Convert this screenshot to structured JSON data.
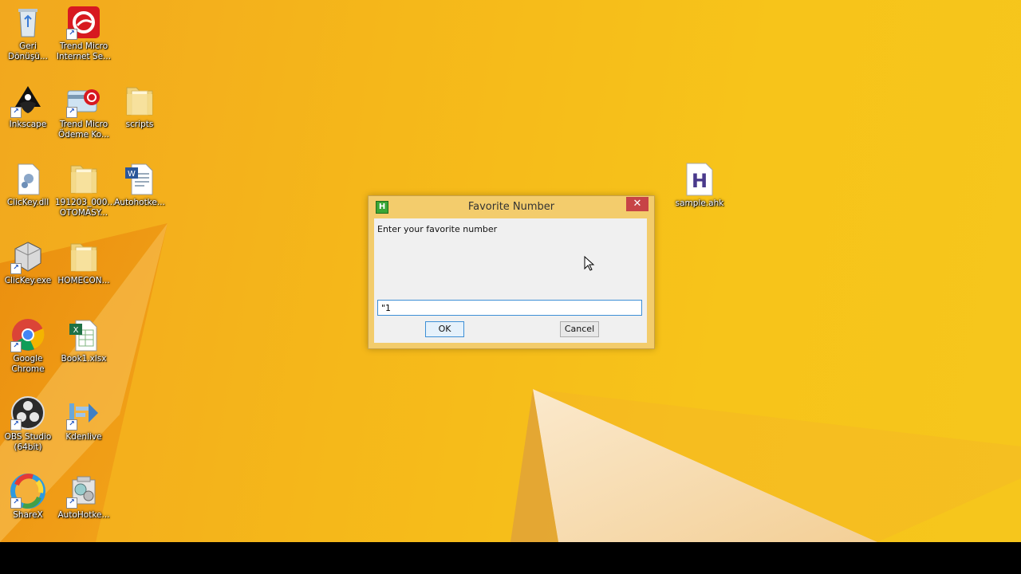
{
  "desktop": {
    "wallpaper_colors": {
      "base": "#f5b81c",
      "orange": "#f08a10",
      "light": "#f7d9a8"
    },
    "icons": [
      {
        "label": "Geri\nDönüşü...",
        "icon": "recycle-bin-icon"
      },
      {
        "label": "Trend Micro\nInternet Se...",
        "icon": "trend-micro-icon"
      },
      {
        "label": "Inkscape",
        "icon": "inkscape-icon"
      },
      {
        "label": "Trend Micro\nÖdeme Ko...",
        "icon": "trend-micro-payment-icon"
      },
      {
        "label": "scripts",
        "icon": "folder-icon"
      },
      {
        "label": "ClicKey.dll",
        "icon": "dll-file-icon"
      },
      {
        "label": "191203_000...\nOTOMASY...",
        "icon": "folder-icon"
      },
      {
        "label": "Autohotke...",
        "icon": "document-icon"
      },
      {
        "label": "ClicKey.exe",
        "icon": "exe-file-icon"
      },
      {
        "label": "HOMECON...",
        "icon": "folder-icon"
      },
      {
        "label": "Google\nChrome",
        "icon": "chrome-icon"
      },
      {
        "label": "Book1.xlsx",
        "icon": "excel-file-icon"
      },
      {
        "label": "OBS Studio\n(64bit)",
        "icon": "obs-icon"
      },
      {
        "label": "Kdenlive",
        "icon": "kdenlive-icon"
      },
      {
        "label": "ShareX",
        "icon": "sharex-icon"
      },
      {
        "label": "AutoHotke...",
        "icon": "autohotkey-installer-icon"
      },
      {
        "label": "sample.ahk",
        "icon": "ahk-file-icon"
      }
    ]
  },
  "dialog": {
    "title": "Favorite Number",
    "app_icon_letter": "H",
    "close_glyph": "✕",
    "prompt": "Enter your favorite number",
    "input_value": "\"1",
    "ok_label": "OK",
    "cancel_label": "Cancel"
  }
}
